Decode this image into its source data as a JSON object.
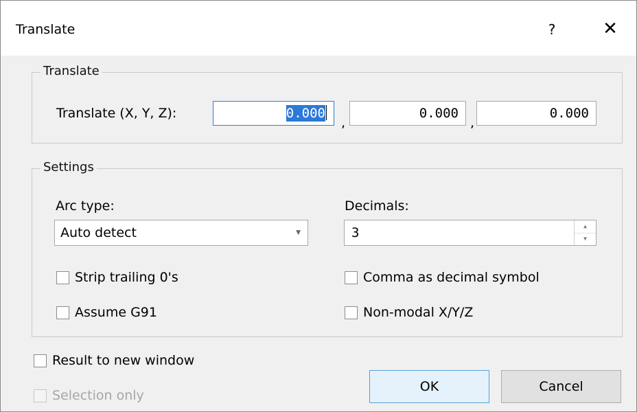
{
  "window": {
    "title": "Translate",
    "help_icon": "?",
    "close_icon": "✕"
  },
  "translate_group": {
    "legend": "Translate",
    "label": "Translate (X, Y, Z):",
    "x_value": "0.000",
    "y_value": "0.000",
    "z_value": "0.000",
    "separator": ","
  },
  "settings_group": {
    "legend": "Settings",
    "arc_type_label": "Arc type:",
    "arc_type_value": "Auto detect",
    "arc_type_arrow": "▼",
    "decimals_label": "Decimals:",
    "decimals_value": "3",
    "spin_up_icon": "▲",
    "spin_down_icon": "▼",
    "strip_trailing": "Strip trailing 0's",
    "assume_g91": "Assume G91",
    "comma_decimal": "Comma as decimal symbol",
    "non_modal": "Non-modal X/Y/Z"
  },
  "options": {
    "result_new_window": "Result to new window",
    "selection_only": "Selection only"
  },
  "buttons": {
    "ok": "OK",
    "cancel": "Cancel"
  }
}
